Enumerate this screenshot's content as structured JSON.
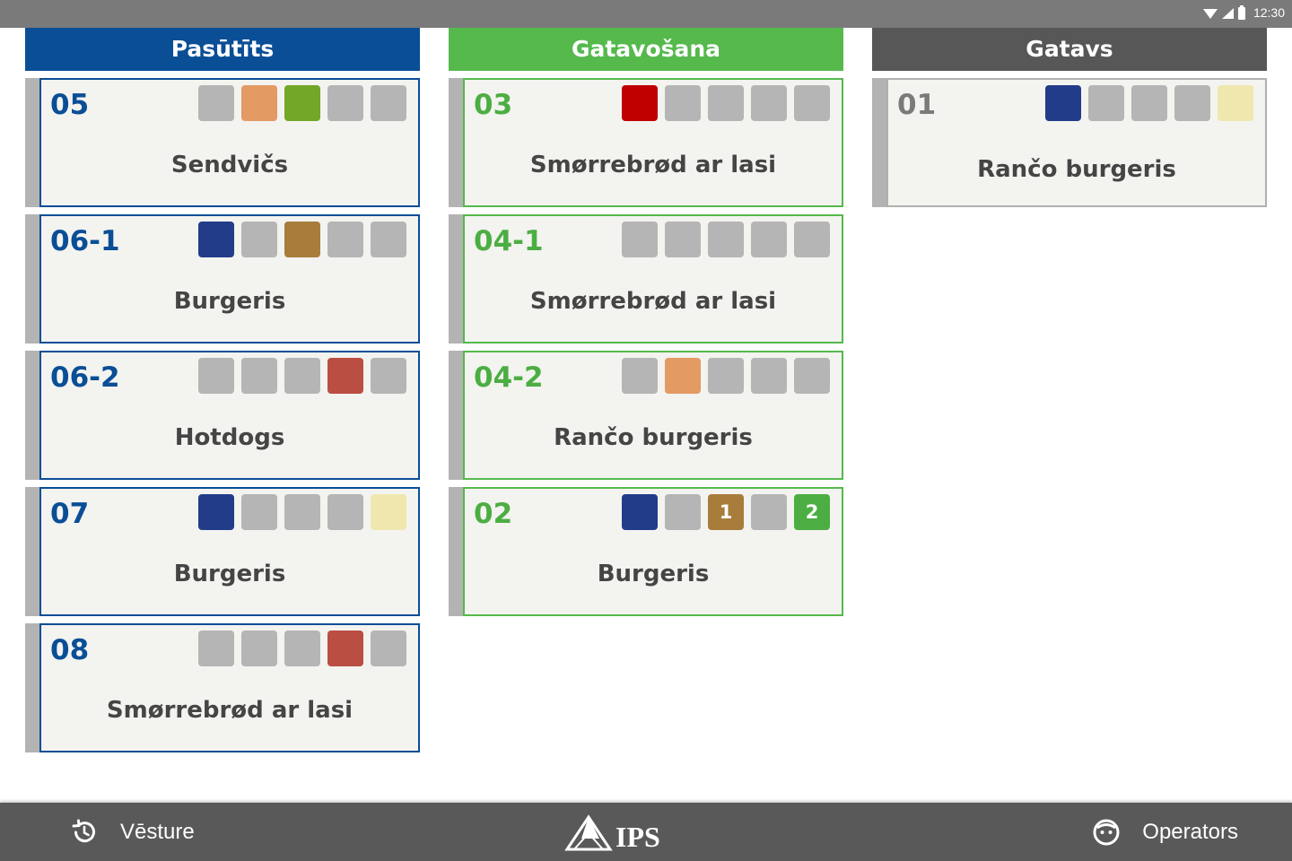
{
  "status": {
    "time": "12:30"
  },
  "colors": {
    "grey": "#b5b5b5",
    "orange": "#e39a63",
    "lime": "#72a728",
    "navy": "#233c8a",
    "bronze": "#a87d3b",
    "red": "#bb4e42",
    "pale": "#efe7ae",
    "crimson": "#c00000",
    "green": "#4cae42"
  },
  "columns": [
    {
      "key": "ordered",
      "title": "Pasūtīts",
      "cards": [
        {
          "id": "05",
          "dish": "Sendvičs",
          "squares": [
            {
              "color": "grey"
            },
            {
              "color": "orange"
            },
            {
              "color": "lime"
            },
            {
              "color": "grey"
            },
            {
              "color": "grey"
            }
          ]
        },
        {
          "id": "06-1",
          "dish": "Burgeris",
          "squares": [
            {
              "color": "navy"
            },
            {
              "color": "grey"
            },
            {
              "color": "bronze"
            },
            {
              "color": "grey"
            },
            {
              "color": "grey"
            }
          ]
        },
        {
          "id": "06-2",
          "dish": "Hotdogs",
          "squares": [
            {
              "color": "grey"
            },
            {
              "color": "grey"
            },
            {
              "color": "grey"
            },
            {
              "color": "red"
            },
            {
              "color": "grey"
            }
          ]
        },
        {
          "id": "07",
          "dish": "Burgeris",
          "squares": [
            {
              "color": "navy"
            },
            {
              "color": "grey"
            },
            {
              "color": "grey"
            },
            {
              "color": "grey"
            },
            {
              "color": "pale"
            }
          ]
        },
        {
          "id": "08",
          "dish": "Smørrebrød ar lasi",
          "squares": [
            {
              "color": "grey"
            },
            {
              "color": "grey"
            },
            {
              "color": "grey"
            },
            {
              "color": "red"
            },
            {
              "color": "grey"
            }
          ]
        }
      ]
    },
    {
      "key": "cooking",
      "title": "Gatavošana",
      "cards": [
        {
          "id": "03",
          "dish": "Smørrebrød ar lasi",
          "squares": [
            {
              "color": "crimson"
            },
            {
              "color": "grey"
            },
            {
              "color": "grey"
            },
            {
              "color": "grey"
            },
            {
              "color": "grey"
            }
          ]
        },
        {
          "id": "04-1",
          "dish": "Smørrebrød ar lasi",
          "squares": [
            {
              "color": "grey"
            },
            {
              "color": "grey"
            },
            {
              "color": "grey"
            },
            {
              "color": "grey"
            },
            {
              "color": "grey"
            }
          ]
        },
        {
          "id": "04-2",
          "dish": "Rančo burgeris",
          "squares": [
            {
              "color": "grey"
            },
            {
              "color": "orange"
            },
            {
              "color": "grey"
            },
            {
              "color": "grey"
            },
            {
              "color": "grey"
            }
          ]
        },
        {
          "id": "02",
          "dish": "Burgeris",
          "squares": [
            {
              "color": "navy"
            },
            {
              "color": "grey"
            },
            {
              "color": "bronze",
              "label": "1"
            },
            {
              "color": "grey"
            },
            {
              "color": "green",
              "label": "2"
            }
          ]
        }
      ]
    },
    {
      "key": "ready",
      "title": "Gatavs",
      "cards": [
        {
          "id": "01",
          "dish": "Rančo burgeris",
          "squares": [
            {
              "color": "navy"
            },
            {
              "color": "grey"
            },
            {
              "color": "grey"
            },
            {
              "color": "grey"
            },
            {
              "color": "pale"
            }
          ]
        }
      ]
    }
  ],
  "footer": {
    "history_label": "Vēsture",
    "logo_text": "IPS",
    "operator_label": "Operators",
    "history_icon": "history-icon",
    "operator_icon": "face-icon"
  }
}
